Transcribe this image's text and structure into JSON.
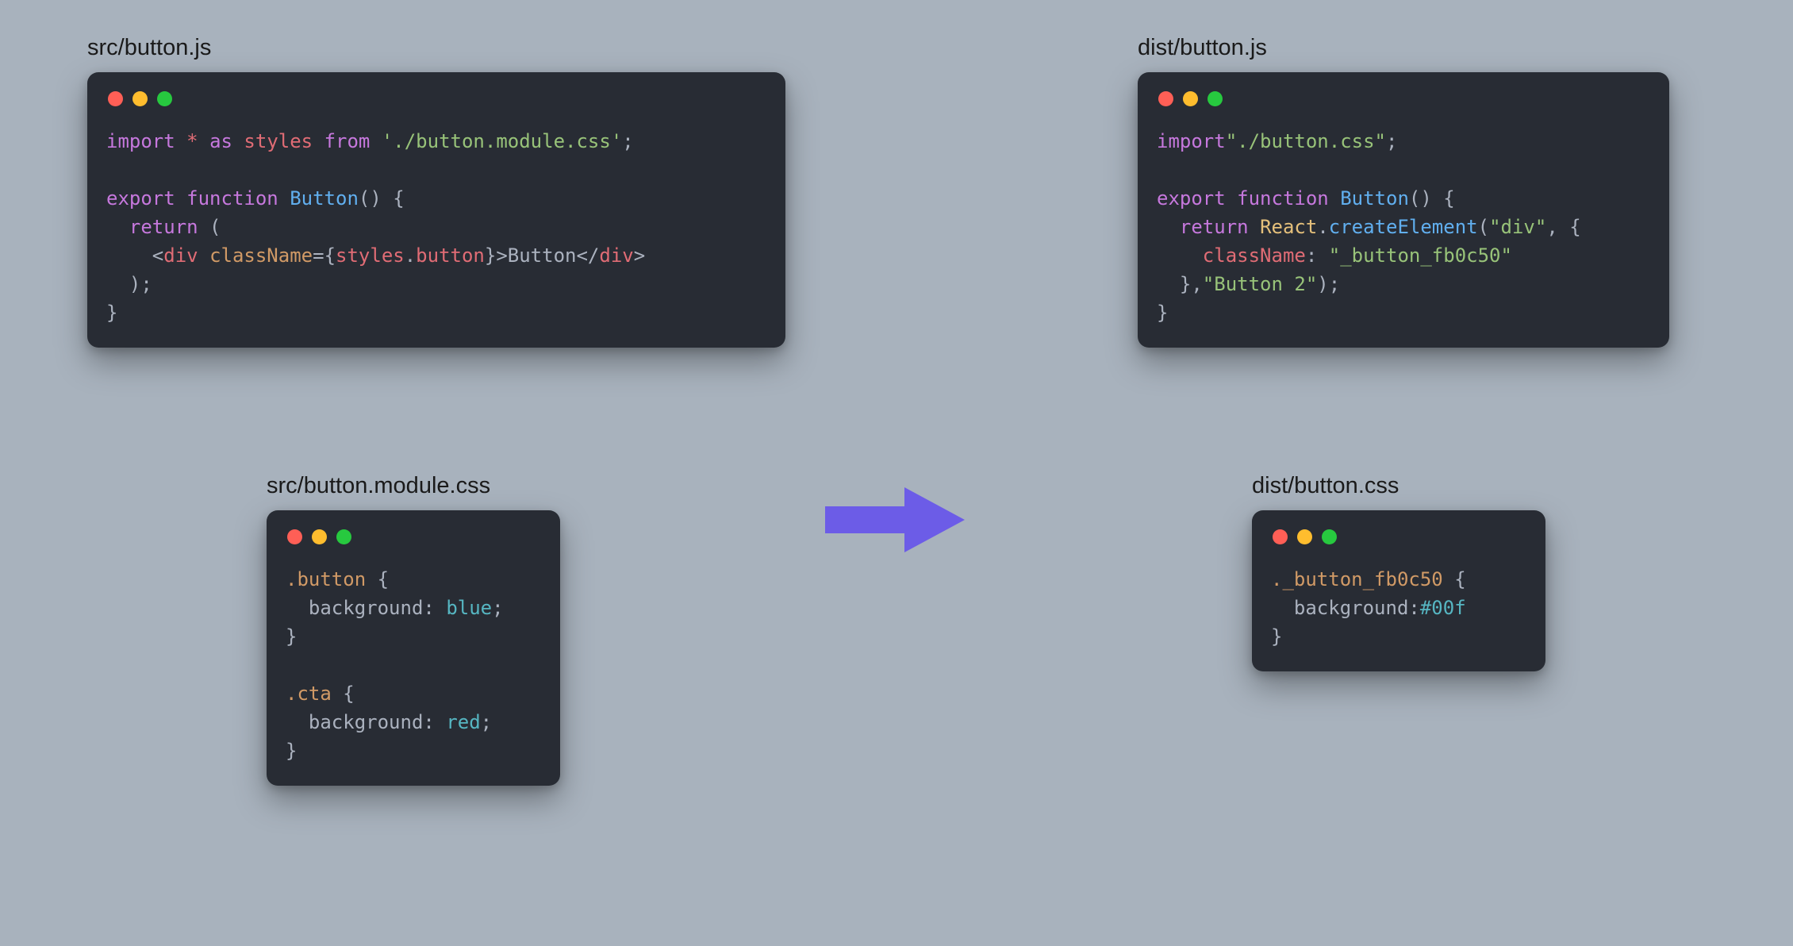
{
  "panels": {
    "src_js": {
      "filename": "src/button.js",
      "code_html": "<span class=\"tk-keyword\">import</span> <span class=\"tk-ident\">*</span> <span class=\"tk-keyword\">as</span> <span class=\"tk-ident\">styles</span> <span class=\"tk-keyword\">from</span> <span class=\"tk-string\">'./button.module.css'</span>;\n\n<span class=\"tk-keyword\">export</span> <span class=\"tk-keyword\">function</span> <span class=\"tk-func\">Button</span>() {\n  <span class=\"tk-keyword\">return</span> (\n    &lt;<span class=\"tk-tag\">div</span> <span class=\"tk-attr\">className</span>=<span class=\"tk-punct\">{</span><span class=\"tk-ident\">styles</span>.<span class=\"tk-ident\">button</span><span class=\"tk-punct\">}</span>&gt;Button&lt;/<span class=\"tk-tag\">div</span>&gt;\n  );\n}"
    },
    "src_css": {
      "filename": "src/button.module.css",
      "code_html": "<span class=\"tk-selector\">.button</span> {\n  <span class=\"tk-text\">background</span>: <span class=\"tk-value\">blue</span>;\n}\n\n<span class=\"tk-selector\">.cta</span> {\n  <span class=\"tk-text\">background</span>: <span class=\"tk-value\">red</span>;\n}"
    },
    "dist_js": {
      "filename": "dist/button.js",
      "code_html": "<span class=\"tk-keyword\">import</span><span class=\"tk-string\">\"./button.css\"</span>;\n\n<span class=\"tk-keyword\">export</span> <span class=\"tk-keyword\">function</span> <span class=\"tk-func\">Button</span>() {\n  <span class=\"tk-keyword\">return</span> <span class=\"tk-react\">React</span>.<span class=\"tk-method\">createElement</span>(<span class=\"tk-string\">\"div\"</span>, {\n    <span class=\"tk-ident\">className</span>: <span class=\"tk-string\">\"_button_fb0c50\"</span>\n  },<span class=\"tk-string\">\"Button 2\"</span>);\n}"
    },
    "dist_css": {
      "filename": "dist/button.css",
      "code_html": "<span class=\"tk-selector\">._button_fb0c50</span> {\n  <span class=\"tk-text\">background</span>:<span class=\"tk-value\">#00f</span>\n}"
    }
  },
  "arrow_color": "#6c5ce7"
}
